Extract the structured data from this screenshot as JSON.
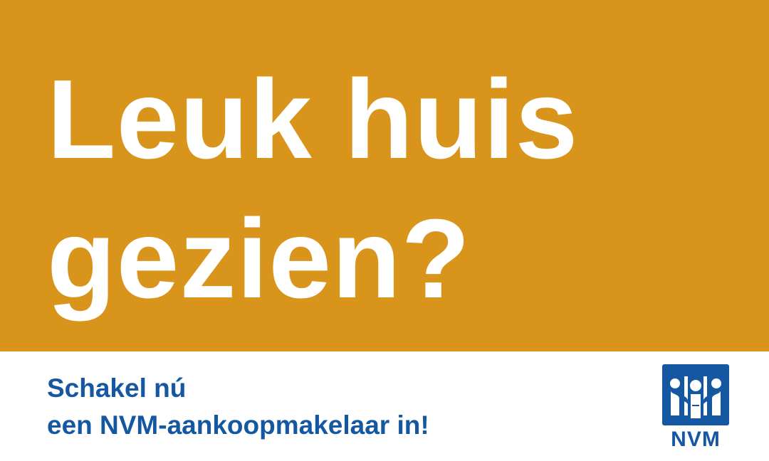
{
  "headline": {
    "line1": "Leuk huis",
    "line2": "gezien?"
  },
  "cta": {
    "line1": "Schakel nú",
    "line2": "een NVM-aankoopmakelaar in!"
  },
  "logo": {
    "text": "NVM",
    "icon": "nvm-figures-icon"
  },
  "colors": {
    "hero_background": "#d9941c",
    "headline_text": "#ffffff",
    "brand_blue": "#1558a1",
    "page_background": "#ffffff"
  }
}
